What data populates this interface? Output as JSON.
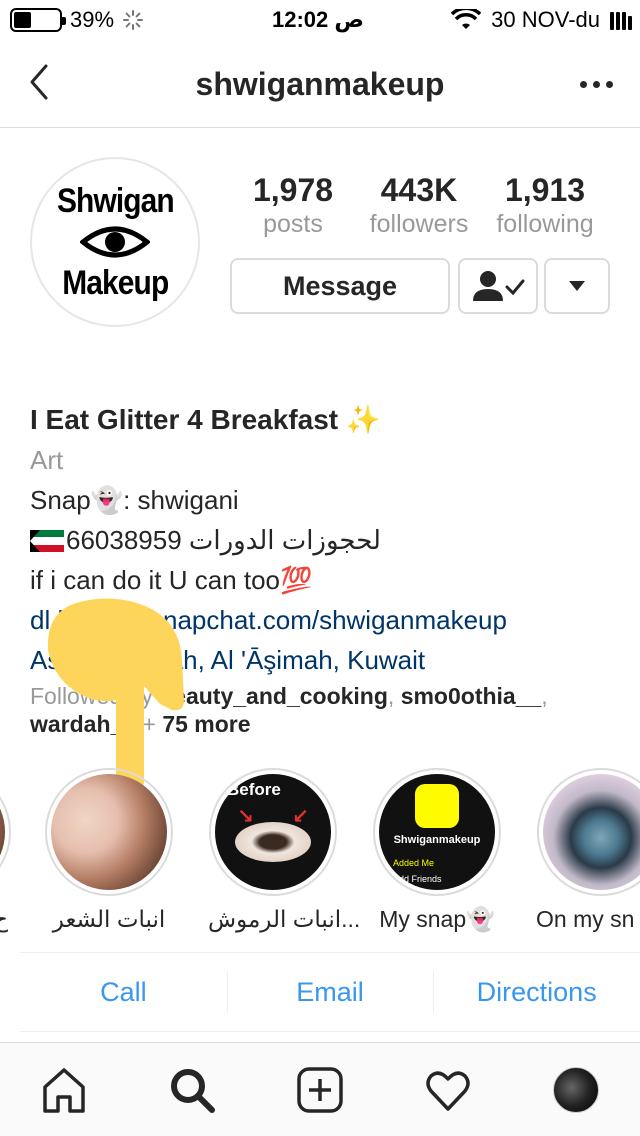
{
  "status_bar": {
    "battery_percent": "39%",
    "battery_level": 0.39,
    "time": "12:02 ص",
    "carrier": "30 NOV-du"
  },
  "nav": {
    "title": "shwiganmakeup",
    "back_icon": "chevron-left-icon",
    "more_icon": "more-dots-icon"
  },
  "profile": {
    "avatar_text_top": "Shwigan",
    "avatar_text_bottom": "Makeup",
    "stats": [
      {
        "num": "1,978",
        "label": "posts"
      },
      {
        "num": "443K",
        "label": "followers"
      },
      {
        "num": "1,913",
        "label": "following"
      }
    ],
    "message_label": "Message",
    "following_icon": "person-check-icon",
    "dropdown_icon": "caret-down-icon"
  },
  "bio": {
    "name": "I Eat Glitter 4 Breakfast ✨",
    "category": "Art",
    "snap_line": "Snap👻: shwigani",
    "phone_line": "66038959 لحجوزات الدورات",
    "motto_line": "if i can do it U can too💯",
    "link": "dl.boxapp.snapchat.com/shwiganmakeup",
    "location": "Ash Shamiyah, Al 'Āşimah, Kuwait",
    "followed_by_prefix": "Followed by ",
    "followed_by_user1": "beauty_and_cooking",
    "followed_by_sep1": ", ",
    "followed_by_user2": "smo0othia__",
    "followed_by_sep2": ",",
    "followed_by_user3": "wardah_4",
    "followed_by_plus": " + ",
    "followed_by_more": "75 more"
  },
  "highlights": [
    {
      "label": "ح"
    },
    {
      "label": "انبات الشعر"
    },
    {
      "label": "انبات الرموش...",
      "before_text": "Before"
    },
    {
      "label": "My snap👻",
      "snap_name": "Shwiganmakeup",
      "snap_row1": "Added Me",
      "snap_row2": "Add Friends"
    },
    {
      "label": "On my sn"
    }
  ],
  "contacts": {
    "call": "Call",
    "email": "Email",
    "directions": "Directions"
  },
  "tabbar": {
    "home_icon": "home-icon",
    "search_icon": "search-icon",
    "add_icon": "add-post-icon",
    "activity_icon": "heart-icon",
    "profile_icon": "profile-avatar-icon"
  },
  "colors": {
    "link_blue": "#003569",
    "action_blue": "#3897f0",
    "muted_gray": "#999999",
    "finger_yellow": "#fdd55b"
  }
}
